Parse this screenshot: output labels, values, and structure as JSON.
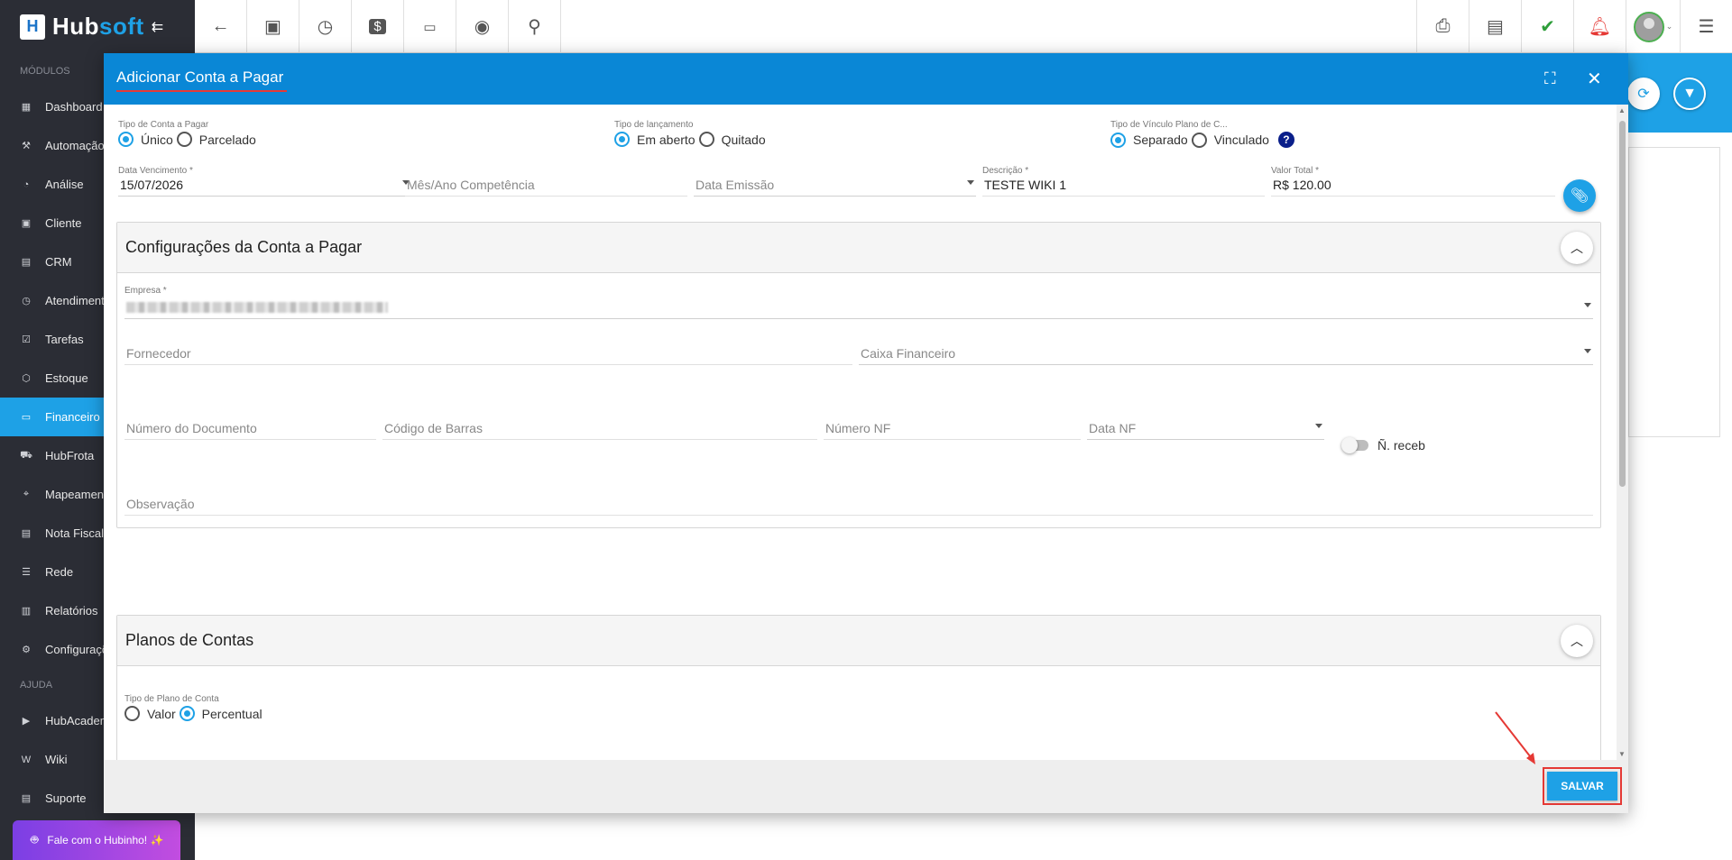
{
  "topbar": {
    "logo_letter": "H",
    "logo_hub": "Hub",
    "logo_soft": "soft",
    "collapse_icon": "⇇",
    "left_buttons": [
      "back-arrow-icon",
      "contact-card-icon",
      "clock-calendar-icon",
      "dollar-icon",
      "terminal-icon",
      "eye-icon",
      "search-icon"
    ],
    "right_buttons": [
      "pdf-icon",
      "briefcase-icon",
      "chat-check-icon",
      "bell-icon",
      "user-avatar",
      "list-menu-icon"
    ]
  },
  "sidebar": {
    "modules_heading": "MÓDULOS",
    "items": [
      {
        "label": "Dashboard",
        "icon": "dashboard-icon"
      },
      {
        "label": "Automação I",
        "icon": "automation-icon"
      },
      {
        "label": "Análise",
        "icon": "pie-chart-icon"
      },
      {
        "label": "Cliente",
        "icon": "client-icon"
      },
      {
        "label": "CRM",
        "icon": "crm-icon"
      },
      {
        "label": "Atendimento",
        "icon": "support-clock-icon"
      },
      {
        "label": "Tarefas",
        "icon": "tasks-icon"
      },
      {
        "label": "Estoque",
        "icon": "box-icon"
      },
      {
        "label": "Financeiro",
        "icon": "finance-icon",
        "active": true
      },
      {
        "label": "HubFrota",
        "icon": "car-icon"
      },
      {
        "label": "Mapeamento",
        "icon": "map-pin-icon"
      },
      {
        "label": "Nota Fiscal",
        "icon": "invoice-icon"
      },
      {
        "label": "Rede",
        "icon": "network-icon"
      },
      {
        "label": "Relatórios",
        "icon": "report-icon"
      },
      {
        "label": "Configuraçõ",
        "icon": "gear-icon"
      }
    ],
    "help_heading": "AJUDA",
    "help_items": [
      {
        "label": "HubAcadem",
        "icon": "youtube-icon"
      },
      {
        "label": "Wiki",
        "icon": "wiki-icon"
      },
      {
        "label": "Suporte",
        "icon": "support-icon"
      }
    ],
    "hubinho_label": "Fale com o Hubinho! ✨"
  },
  "modal": {
    "title": "Adicionar Conta a Pagar",
    "tipo_conta": {
      "label": "Tipo de Conta a Pagar",
      "options": [
        "Único",
        "Parcelado"
      ],
      "selected": "Único"
    },
    "tipo_lancamento": {
      "label": "Tipo de lançamento",
      "options": [
        "Em aberto",
        "Quitado"
      ],
      "selected": "Em aberto"
    },
    "tipo_vinculo": {
      "label": "Tipo de Vínculo Plano de C...",
      "options": [
        "Separado",
        "Vinculado"
      ],
      "selected": "Separado",
      "help": "?"
    },
    "data_vencimento": {
      "label": "Data Vencimento",
      "value": "15/07/2026"
    },
    "mes_ano": {
      "placeholder": "Mês/Ano Competência"
    },
    "data_emissao": {
      "placeholder": "Data Emissão"
    },
    "descricao": {
      "label": "Descrição",
      "value": "TESTE WIKI 1"
    },
    "valor_total": {
      "label": "Valor Total",
      "value": "R$ 120.00"
    },
    "required_mark": "*",
    "config_panel": {
      "title": "Configurações da Conta a Pagar",
      "empresa_label": "Empresa",
      "fornecedor_placeholder": "Fornecedor",
      "caixa_placeholder": "Caixa Financeiro",
      "numero_doc_placeholder": "Número do Documento",
      "codigo_barras_placeholder": "Código de Barras",
      "numero_nf_placeholder": "Número NF",
      "data_nf_placeholder": "Data NF",
      "n_receb_label": "Ñ. receb",
      "observacao_placeholder": "Observação"
    },
    "planos_panel": {
      "title": "Planos de Contas",
      "tipo_label": "Tipo de Plano de Conta",
      "options": [
        "Valor",
        "Percentual"
      ],
      "selected": "Percentual"
    },
    "save_label": "SALVAR"
  },
  "colors": {
    "accent": "#1ea1e6",
    "header": "#0a87d6",
    "sidebar": "#2b2d35",
    "highlight": "#e53935"
  }
}
